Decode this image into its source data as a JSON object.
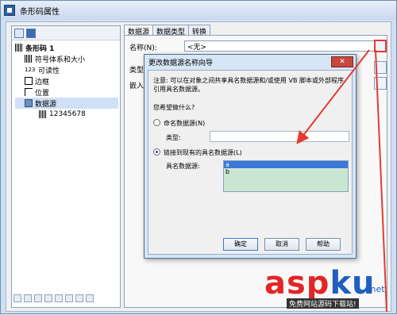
{
  "window": {
    "title": "条形码属性"
  },
  "tree": {
    "root": "条形码 1",
    "items": [
      {
        "icon": "barcode-icon",
        "label": "符号体系和大小",
        "level": 1
      },
      {
        "icon": "readable-icon",
        "prefix": "123",
        "label": "可读性",
        "level": 1
      },
      {
        "icon": "border-icon",
        "label": "边框",
        "level": 1
      },
      {
        "icon": "position-icon",
        "label": "位置",
        "level": 1
      },
      {
        "icon": "datasource-icon",
        "label": "数据源",
        "level": 1
      },
      {
        "icon": "barcode-data-icon",
        "label": "12345678",
        "level": 2
      }
    ]
  },
  "tabs": [
    "数据源",
    "数据类型",
    "转换"
  ],
  "form": {
    "name_label": "名称(N):",
    "name_value": "<无>",
    "type_label": "类型(T)",
    "embed_label": "嵌入的"
  },
  "dialog": {
    "title": "更改数据源名称向导",
    "close": "✕",
    "note": "注意: 可以在对象之间共享具名数据源和/或使用 VB 脚本或外部程序引用具名数据源。",
    "question": "您希望做什么?",
    "option1": "命名数据源(N)",
    "type_label": "类型:",
    "option2": "链接到现有的具名数据源(L)",
    "named_label": "具名数据源:",
    "list": [
      "a",
      "b"
    ],
    "ok": "确定",
    "cancel": "取消",
    "help": "帮助"
  },
  "watermark": {
    "asp": "asp",
    "k": "ku",
    "net": ".net",
    "sub": "免费网站源码下载站!"
  },
  "colors": {
    "arrow": "#e63a32",
    "list_bg": "#c9e6d3",
    "selected": "#3b78d8"
  }
}
